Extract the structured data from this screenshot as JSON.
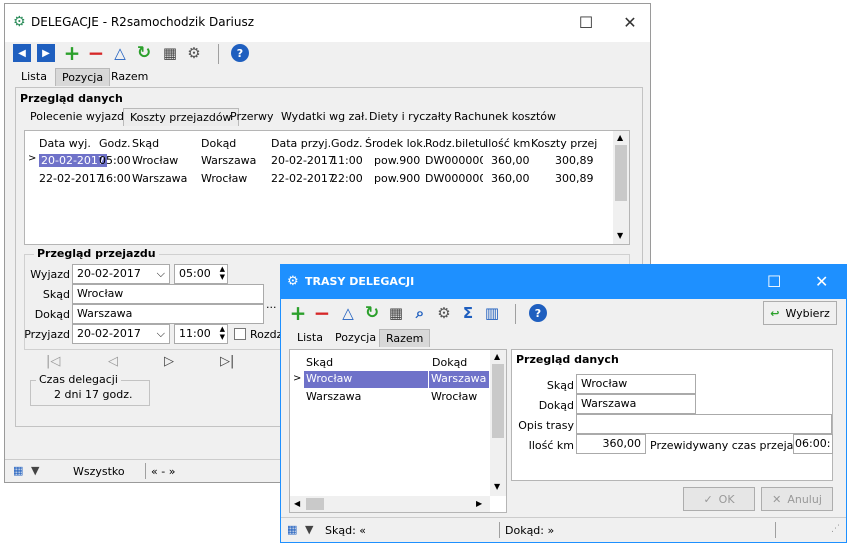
{
  "main_window": {
    "title": "DELEGACJE - R2samochodzik Dariusz",
    "controls": {
      "minimize": "—",
      "maximize": "☐",
      "close": "✕"
    },
    "tabs": [
      "Lista",
      "Pozycja",
      "Razem"
    ],
    "section_title": "Przegląd danych",
    "subtabs": [
      "Polecenie wyjazdu",
      "Koszty przejazdów",
      "Przerwy",
      "Wydatki wg zał.",
      "Diety i ryczałty",
      "Rachunek kosztów"
    ],
    "table": {
      "columns": [
        "Data wyj.",
        "Godz.",
        "Skąd",
        "Dokąd",
        "Data przyj.",
        "Godz.",
        "Środek lok.",
        "Rodz.biletu",
        "Ilość km",
        "Koszty przej"
      ],
      "rows": [
        [
          "20-02-2017",
          "05:00",
          "Wrocław",
          "Warszawa",
          "20-02-2017",
          "11:00",
          "pow.900",
          "DW000000 (",
          "360,00",
          "300,89"
        ],
        [
          "22-02-2017",
          "16:00",
          "Warszawa",
          "Wrocław",
          "22-02-2017",
          "22:00",
          "pow.900",
          "DW000000 (",
          "360,00",
          "300,89"
        ]
      ]
    },
    "przejazd": {
      "title": "Przegląd przejazdu",
      "wyjazd_label": "Wyjazd",
      "wyjazd_date": "20-02-2017",
      "wyjazd_time": "05:00",
      "skad_label": "Skąd",
      "skad_value": "Wrocław",
      "dokad_label": "Dokąd",
      "dokad_value": "Warszawa",
      "ellipsis": "...",
      "przyjazd_label": "Przyjazd",
      "przyjazd_date": "20-02-2017",
      "przyjazd_time": "11:00",
      "rozdz_label": "Rozdzi"
    },
    "nav": [
      "|◁",
      "◁",
      "▷",
      "▷|"
    ],
    "czas": {
      "label": "Czas delegacji",
      "value": "2 dni 17 godz."
    },
    "status": {
      "filter": "Wszystko",
      "range": "« - »"
    }
  },
  "dialog": {
    "title": "TRASY DELEGACJI",
    "controls": {
      "maximize": "☐",
      "close": "✕"
    },
    "wybierz_label": "Wybierz",
    "tabs": [
      "Lista",
      "Pozycja",
      "Razem"
    ],
    "list": {
      "columns": [
        "Skąd",
        "Dokąd"
      ],
      "rows": [
        [
          "Wrocław",
          "Warszawa"
        ],
        [
          "Warszawa",
          "Wrocław"
        ]
      ]
    },
    "details": {
      "title": "Przegląd danych",
      "skad_label": "Skąd",
      "skad_value": "Wrocław",
      "dokad_label": "Dokąd",
      "dokad_value": "Warszawa",
      "opis_label": "Opis trasy",
      "opis_value": "",
      "km_label": "Ilość km",
      "km_value": "360,00",
      "czas_label": "Przewidywany czas przejazdu",
      "czas_value": "06:00:"
    },
    "ok_label": "OK",
    "anuluj_label": "Anuluj",
    "status": {
      "skad": "Skąd: «",
      "dokad": "Dokąd: »"
    }
  },
  "colors": {
    "accent": "#1e90ff",
    "selection": "#6f72c9",
    "green": "#2ca02c",
    "red": "#d62728",
    "blue_nav": "#1f5fbf"
  }
}
